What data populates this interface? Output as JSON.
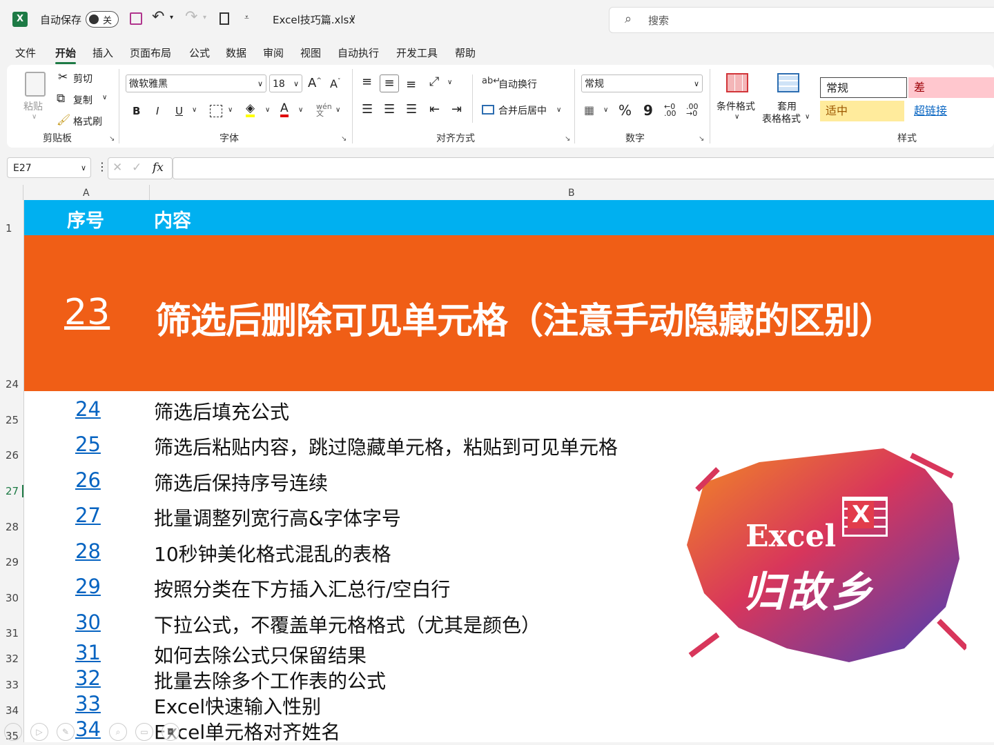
{
  "titlebar": {
    "autosave_label": "自动保存",
    "autosave_state": "关",
    "filename": "Excel技巧篇.xlsx",
    "search_placeholder": "搜索"
  },
  "menu": [
    "文件",
    "开始",
    "插入",
    "页面布局",
    "公式",
    "数据",
    "审阅",
    "视图",
    "自动执行",
    "开发工具",
    "帮助"
  ],
  "ribbon": {
    "clipboard": {
      "paste": "粘贴",
      "cut": "剪切",
      "copy": "复制",
      "format_painter": "格式刷",
      "label": "剪贴板"
    },
    "font": {
      "name": "微软雅黑",
      "size": "18",
      "bold": "B",
      "italic": "I",
      "underline": "U",
      "label": "字体"
    },
    "alignment": {
      "wrap": "自动换行",
      "merge": "合并后居中",
      "label": "对齐方式"
    },
    "number": {
      "format": "常规",
      "percent": "%",
      "comma": "9",
      "label": "数字"
    },
    "styles": {
      "conditional": "条件格式",
      "table_fmt_1": "套用",
      "table_fmt_2": "表格格式",
      "normal": "常规",
      "bad": "差",
      "neutral": "适中",
      "hyperlink": "超链接",
      "label": "样式"
    }
  },
  "formula_bar": {
    "cell_ref": "E27",
    "fx": "fx",
    "content": ""
  },
  "columns": [
    "A",
    "B"
  ],
  "header_row": {
    "row_num": "1",
    "col_a": "序号",
    "col_b": "内容"
  },
  "featured": {
    "row_num": "24",
    "number": "23",
    "title": "筛选后删除可见单元格（注意手动隐藏的区别）"
  },
  "rows": [
    {
      "row_num": "25",
      "number": "24",
      "text": "筛选后填充公式"
    },
    {
      "row_num": "26",
      "number": "25",
      "text": "筛选后粘贴内容，跳过隐藏单元格，粘贴到可见单元格"
    },
    {
      "row_num": "27",
      "number": "26",
      "text": "筛选后保持序号连续"
    },
    {
      "row_num": "28",
      "number": "27",
      "text": "批量调整列宽行高&字体字号"
    },
    {
      "row_num": "29",
      "number": "28",
      "text": "10秒钟美化格式混乱的表格"
    },
    {
      "row_num": "30",
      "number": "29",
      "text": "按照分类在下方插入汇总行/空白行"
    },
    {
      "row_num": "31",
      "number": "30",
      "text": "下拉公式，不覆盖单元格格式（尤其是颜色）"
    },
    {
      "row_num": "32",
      "number": "31",
      "text": "如何去除公式只保留结果"
    },
    {
      "row_num": "33",
      "number": "32",
      "text": "批量去除多个工作表的公式"
    },
    {
      "row_num": "34",
      "number": "33",
      "text": "Excel快速输入性别"
    },
    {
      "row_num": "35",
      "number": "34",
      "text": "Excel单元格对齐姓名"
    }
  ],
  "watermark": {
    "line1": "Excel",
    "line2": "归故乡",
    "icon_letter": "X"
  },
  "colors": {
    "header_blue": "#00b0f0",
    "featured_orange": "#f05e16",
    "link_blue": "#0563c1",
    "excel_green": "#1d7a45"
  }
}
